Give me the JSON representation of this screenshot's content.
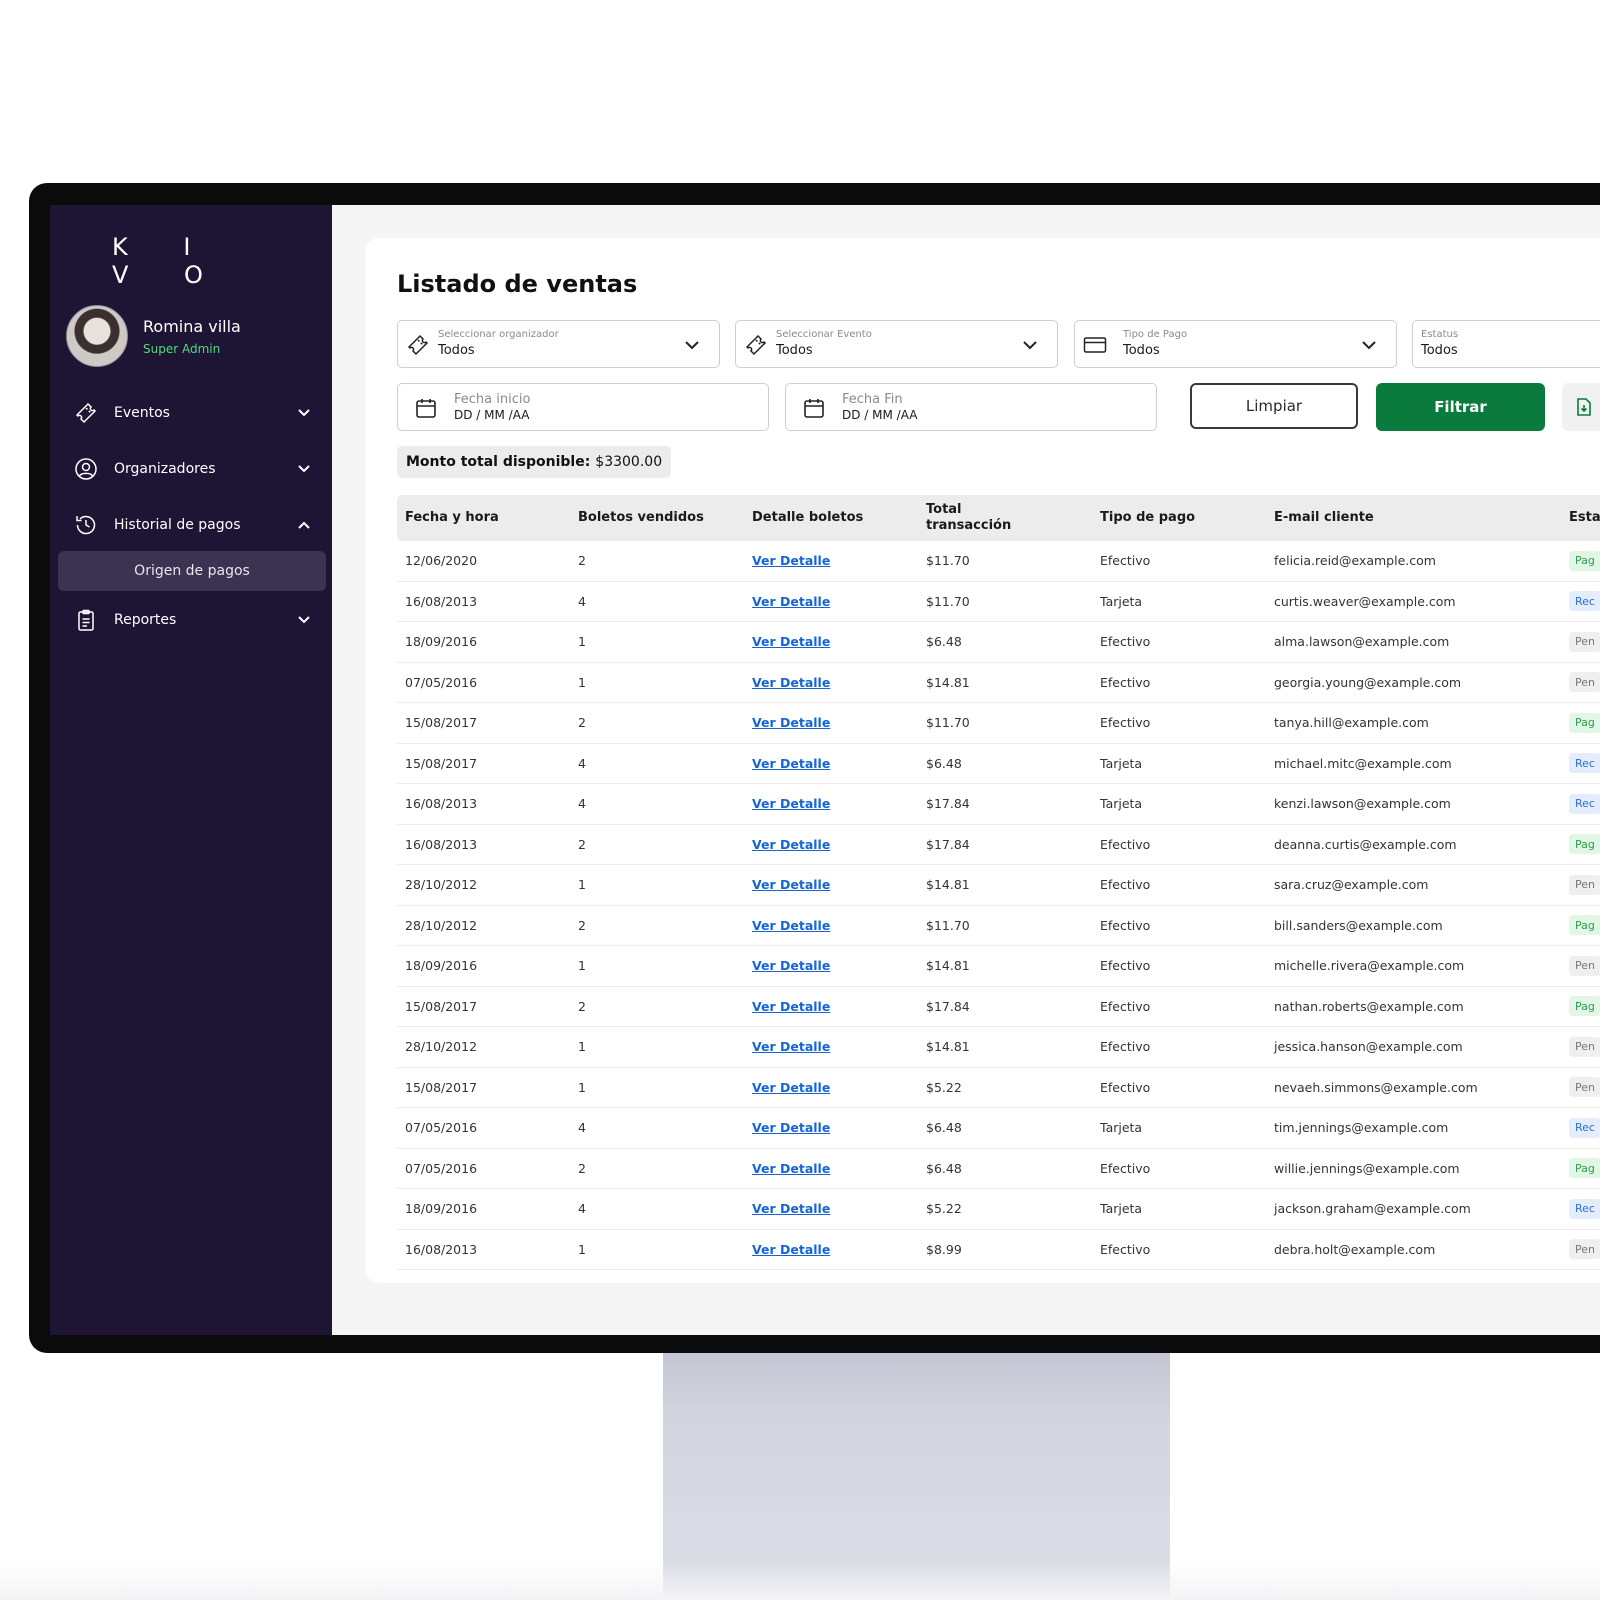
{
  "brand": "K I V O",
  "user": {
    "name": "Romina villa",
    "role": "Super Admin"
  },
  "sidebar": {
    "items": [
      {
        "label": "Eventos",
        "icon": "ticket-icon",
        "expanded": false
      },
      {
        "label": "Organizadores",
        "icon": "user-circle-icon",
        "expanded": false
      },
      {
        "label": "Historial de pagos",
        "icon": "history-icon",
        "expanded": true
      },
      {
        "label": "Reportes",
        "icon": "clipboard-icon",
        "expanded": false
      }
    ],
    "subitem": "Origen de pagos"
  },
  "page": {
    "title": "Listado de ventas"
  },
  "filters": {
    "organizador": {
      "caption": "Seleccionar organizador",
      "value": "Todos"
    },
    "evento": {
      "caption": "Seleccionar Evento",
      "value": "Todos"
    },
    "tipo_pago": {
      "caption": "Tipo de Pago",
      "value": "Todos"
    },
    "estatus": {
      "caption": "Estatus",
      "value": "Todos"
    },
    "fecha_inicio": {
      "caption": "Fecha inicio",
      "value": "DD / MM /AA"
    },
    "fecha_fin": {
      "caption": "Fecha Fin",
      "value": "DD / MM /AA"
    }
  },
  "buttons": {
    "clear": "Limpiar",
    "filter": "Filtrar"
  },
  "summary": {
    "label": "Monto total disponible:",
    "value": "$3300.00"
  },
  "table": {
    "columns": [
      "Fecha y hora",
      "Boletos vendidos",
      "Detalle boletos",
      "Total transacción",
      "Tipo de pago",
      "E-mail cliente",
      "Estat"
    ],
    "link_label": "Ver Detalle",
    "rows": [
      {
        "date": "12/06/2020",
        "qty": "2",
        "total": "$11.70",
        "tipo": "Efectivo",
        "email": "felicia.reid@example.com",
        "status": "Pag",
        "status_type": "pag"
      },
      {
        "date": "16/08/2013",
        "qty": "4",
        "total": "$11.70",
        "tipo": "Tarjeta",
        "email": "curtis.weaver@example.com",
        "status": "Rec",
        "status_type": "rec"
      },
      {
        "date": "18/09/2016",
        "qty": "1",
        "total": "$6.48",
        "tipo": "Efectivo",
        "email": "alma.lawson@example.com",
        "status": "Pen",
        "status_type": "pen"
      },
      {
        "date": "07/05/2016",
        "qty": "1",
        "total": "$14.81",
        "tipo": "Efectivo",
        "email": "georgia.young@example.com",
        "status": "Pen",
        "status_type": "pen"
      },
      {
        "date": "15/08/2017",
        "qty": "2",
        "total": "$11.70",
        "tipo": "Efectivo",
        "email": "tanya.hill@example.com",
        "status": "Pag",
        "status_type": "pag"
      },
      {
        "date": "15/08/2017",
        "qty": "4",
        "total": "$6.48",
        "tipo": "Tarjeta",
        "email": "michael.mitc@example.com",
        "status": "Rec",
        "status_type": "rec"
      },
      {
        "date": "16/08/2013",
        "qty": "4",
        "total": "$17.84",
        "tipo": "Tarjeta",
        "email": "kenzi.lawson@example.com",
        "status": "Rec",
        "status_type": "rec"
      },
      {
        "date": "16/08/2013",
        "qty": "2",
        "total": "$17.84",
        "tipo": "Efectivo",
        "email": "deanna.curtis@example.com",
        "status": "Pag",
        "status_type": "pag"
      },
      {
        "date": "28/10/2012",
        "qty": "1",
        "total": "$14.81",
        "tipo": "Efectivo",
        "email": "sara.cruz@example.com",
        "status": "Pen",
        "status_type": "pen"
      },
      {
        "date": "28/10/2012",
        "qty": "2",
        "total": "$11.70",
        "tipo": "Efectivo",
        "email": "bill.sanders@example.com",
        "status": "Pag",
        "status_type": "pag"
      },
      {
        "date": "18/09/2016",
        "qty": "1",
        "total": "$14.81",
        "tipo": "Efectivo",
        "email": "michelle.rivera@example.com",
        "status": "Pen",
        "status_type": "pen"
      },
      {
        "date": "15/08/2017",
        "qty": "2",
        "total": "$17.84",
        "tipo": "Efectivo",
        "email": "nathan.roberts@example.com",
        "status": "Pag",
        "status_type": "pag"
      },
      {
        "date": "28/10/2012",
        "qty": "1",
        "total": "$14.81",
        "tipo": "Efectivo",
        "email": "jessica.hanson@example.com",
        "status": "Pen",
        "status_type": "pen"
      },
      {
        "date": "15/08/2017",
        "qty": "1",
        "total": "$5.22",
        "tipo": "Efectivo",
        "email": "nevaeh.simmons@example.com",
        "status": "Pen",
        "status_type": "pen"
      },
      {
        "date": "07/05/2016",
        "qty": "4",
        "total": "$6.48",
        "tipo": "Tarjeta",
        "email": "tim.jennings@example.com",
        "status": "Rec",
        "status_type": "rec"
      },
      {
        "date": "07/05/2016",
        "qty": "2",
        "total": "$6.48",
        "tipo": "Efectivo",
        "email": "willie.jennings@example.com",
        "status": "Pag",
        "status_type": "pag"
      },
      {
        "date": "18/09/2016",
        "qty": "4",
        "total": "$5.22",
        "tipo": "Tarjeta",
        "email": "jackson.graham@example.com",
        "status": "Rec",
        "status_type": "rec"
      },
      {
        "date": "16/08/2013",
        "qty": "1",
        "total": "$8.99",
        "tipo": "Efectivo",
        "email": "debra.holt@example.com",
        "status": "Pen",
        "status_type": "pen"
      }
    ]
  }
}
